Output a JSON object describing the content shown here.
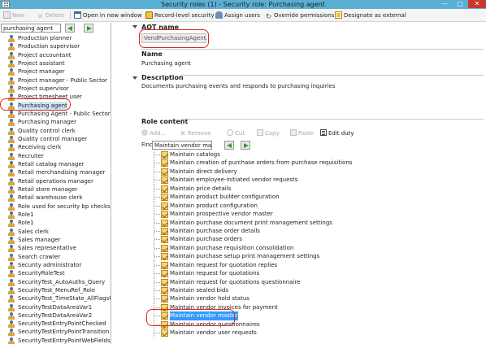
{
  "window": {
    "title": "Security roles (1) - Security role: Purchasing agent",
    "minimize": "—",
    "maximize": "□",
    "close": "✕"
  },
  "toolbar": {
    "new": "New",
    "delete": "Delete",
    "open_new_window": "Open in new window",
    "record_level_security": "Record-level security",
    "assign_users": "Assign users",
    "override_permissions": "Override permissions",
    "designate_as_external": "Designate as external"
  },
  "left_pane": {
    "search_value": "purchasing agent",
    "roles": [
      "Production planner",
      "Production supervisor",
      "Project accountant",
      "Project assistant",
      "Project manager",
      "Project manager - Public Sector",
      "Project supervisor",
      "Project timesheet user",
      "Purchasing agent",
      "Purchasing Agent - Public Sector",
      "Purchasing manager",
      "Quality control clerk",
      "Quality control manager",
      "Receiving clerk",
      "Recruiter",
      "Retail catalog manager",
      "Retail merchandising manager",
      "Retail operations manager",
      "Retail store manager",
      "Retail warehouse clerk",
      "Role used for security bp checks test",
      "Role1",
      "Role1",
      "Sales clerk",
      "Sales manager",
      "Sales representative",
      "Search crawler",
      "Security administrator",
      "SecurityRoleTest",
      "SecurityTest_AutoAuths_Query",
      "SecurityTest_MenuRef_Role",
      "SecurityTest_TimeState_AllFlagsUnc",
      "SecurityTestDataAreaVar1",
      "SecurityTestDataAreaVar2",
      "SecurityTestEntryPointChecked",
      "SecurityTestEntryPointTransition",
      "SecurityTestEntryPointWebFields"
    ],
    "selected_index": 8
  },
  "details": {
    "aot_name_label": "AOT name",
    "aot_name_value": "VendPurchasingAgent",
    "name_label": "Name",
    "name_value": "Purchasing agent",
    "description_label": "Description",
    "description_value": "Documents purchasing events and responds to purchasing inquiries",
    "role_content_label": "Role content"
  },
  "role_content_toolbar": {
    "add": "Add...",
    "remove": "Remove",
    "cut": "Cut",
    "copy": "Copy",
    "paste": "Paste",
    "edit_duty": "Edit duty"
  },
  "find": {
    "label": "Find:",
    "value": "Maintain vendor master"
  },
  "duties": [
    "Maintain catalogs",
    "Maintain creation of purchase orders from purchase requisitions",
    "Maintain direct delivery",
    "Maintain employee-initiated vendor requests",
    "Maintain price details",
    "Maintain product builder configuration",
    "Maintain product configuration",
    "Maintain prospective vendor master",
    "Maintain purchase document print management settings",
    "Maintain purchase order details",
    "Maintain purchase orders",
    "Maintain purchase requisition consolidation",
    "Maintain purchase setup print management settings",
    "Maintain request for quotation replies",
    "Maintain request for quotations",
    "Maintain request for quotations questionnaire",
    "Maintain sealed bids",
    "Maintain vendor hold status",
    "Maintain vendor invoices for payment",
    "Maintain vendor master",
    "Maintain vendor questionnaires",
    "Maintain vendor user requests"
  ],
  "selected_duty_index": 19,
  "colors": {
    "titlebar": "#5ab0d2",
    "annotation_red": "#e0281e",
    "selection_blue": "#3399ff"
  }
}
